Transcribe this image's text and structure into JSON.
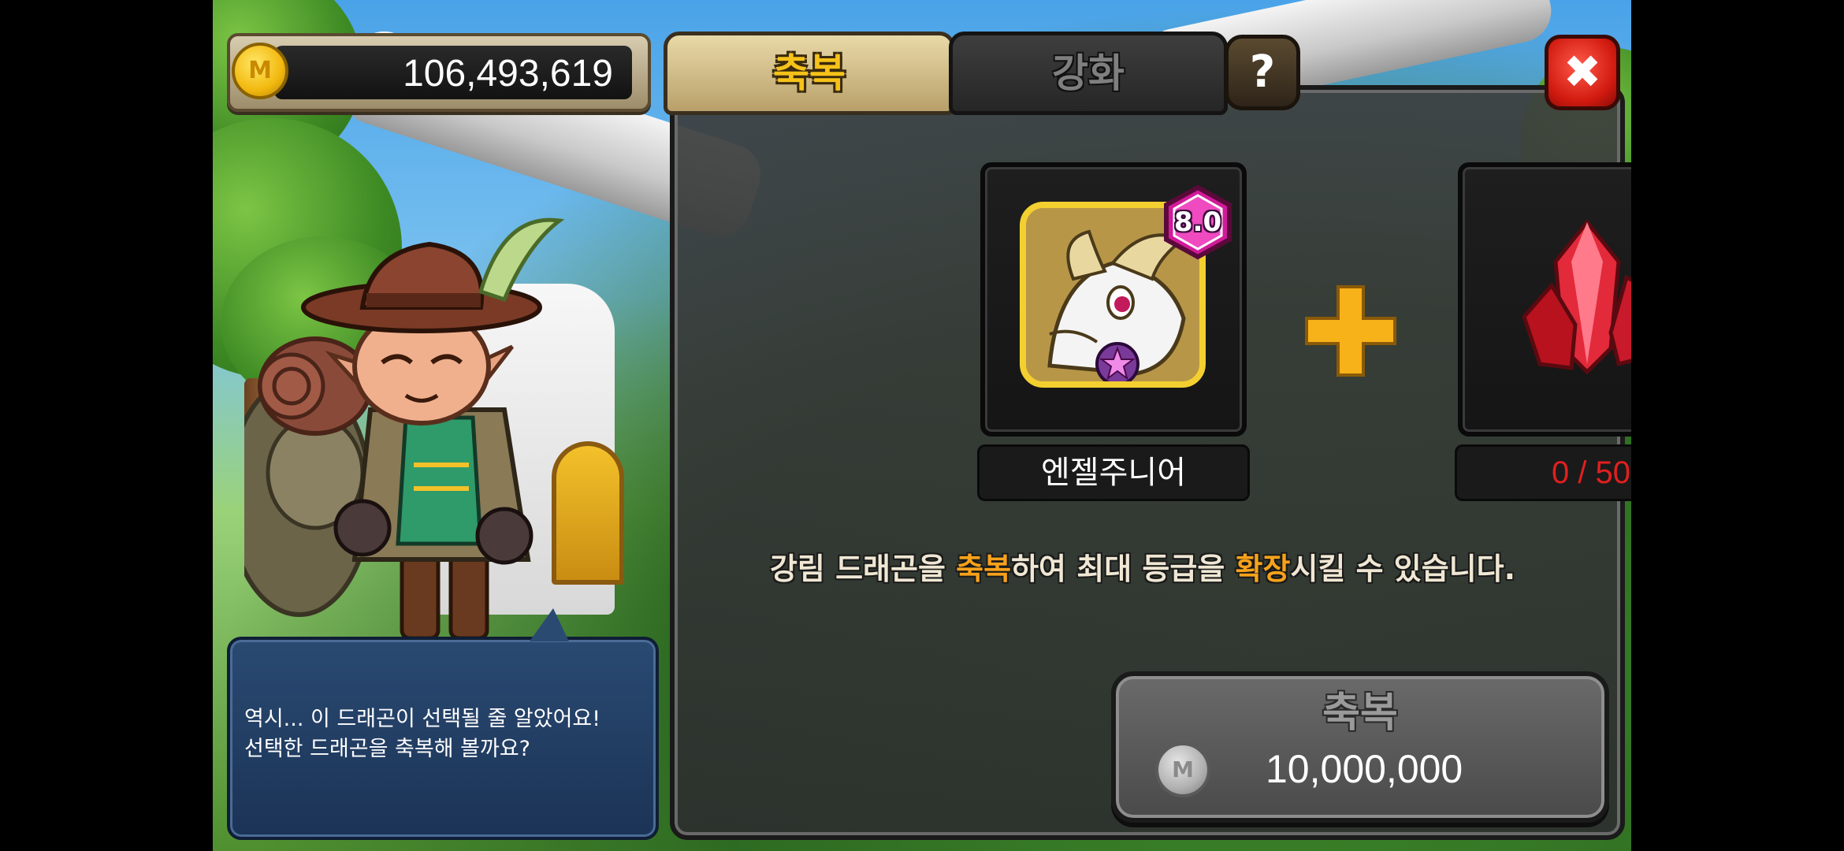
{
  "currency": {
    "icon": "gold-coin-icon",
    "coin_letter": "M",
    "value": "106,493,619"
  },
  "tabs": [
    {
      "label": "축복",
      "active": true
    },
    {
      "label": "강화",
      "active": false
    }
  ],
  "help": {
    "label": "?"
  },
  "close": {
    "label": "✖"
  },
  "dragon_slot": {
    "name": "엔젤주니어",
    "grade": "8.0",
    "icon": "dragon-portrait-icon"
  },
  "material_slot": {
    "count": "0 / 50",
    "icon": "red-crystal-icon"
  },
  "description": {
    "part1": "강림 드래곤을 ",
    "highlight1": "축복",
    "part2": "하여 최대 등급을 ",
    "highlight2": "확장",
    "part3": "시킬 수 있습니다."
  },
  "bless_button": {
    "label": "축복",
    "coin_letter": "M",
    "cost": "10,000,000"
  },
  "dialog": {
    "line1": "역시... 이 드래곤이 선택될 줄 알았어요!",
    "line2": "선택한 드래곤을 축복해 볼까요?"
  },
  "colors": {
    "highlight": "#f7a21a",
    "count_red": "#e21f1f",
    "tab_active_text": "#f6c21a"
  }
}
